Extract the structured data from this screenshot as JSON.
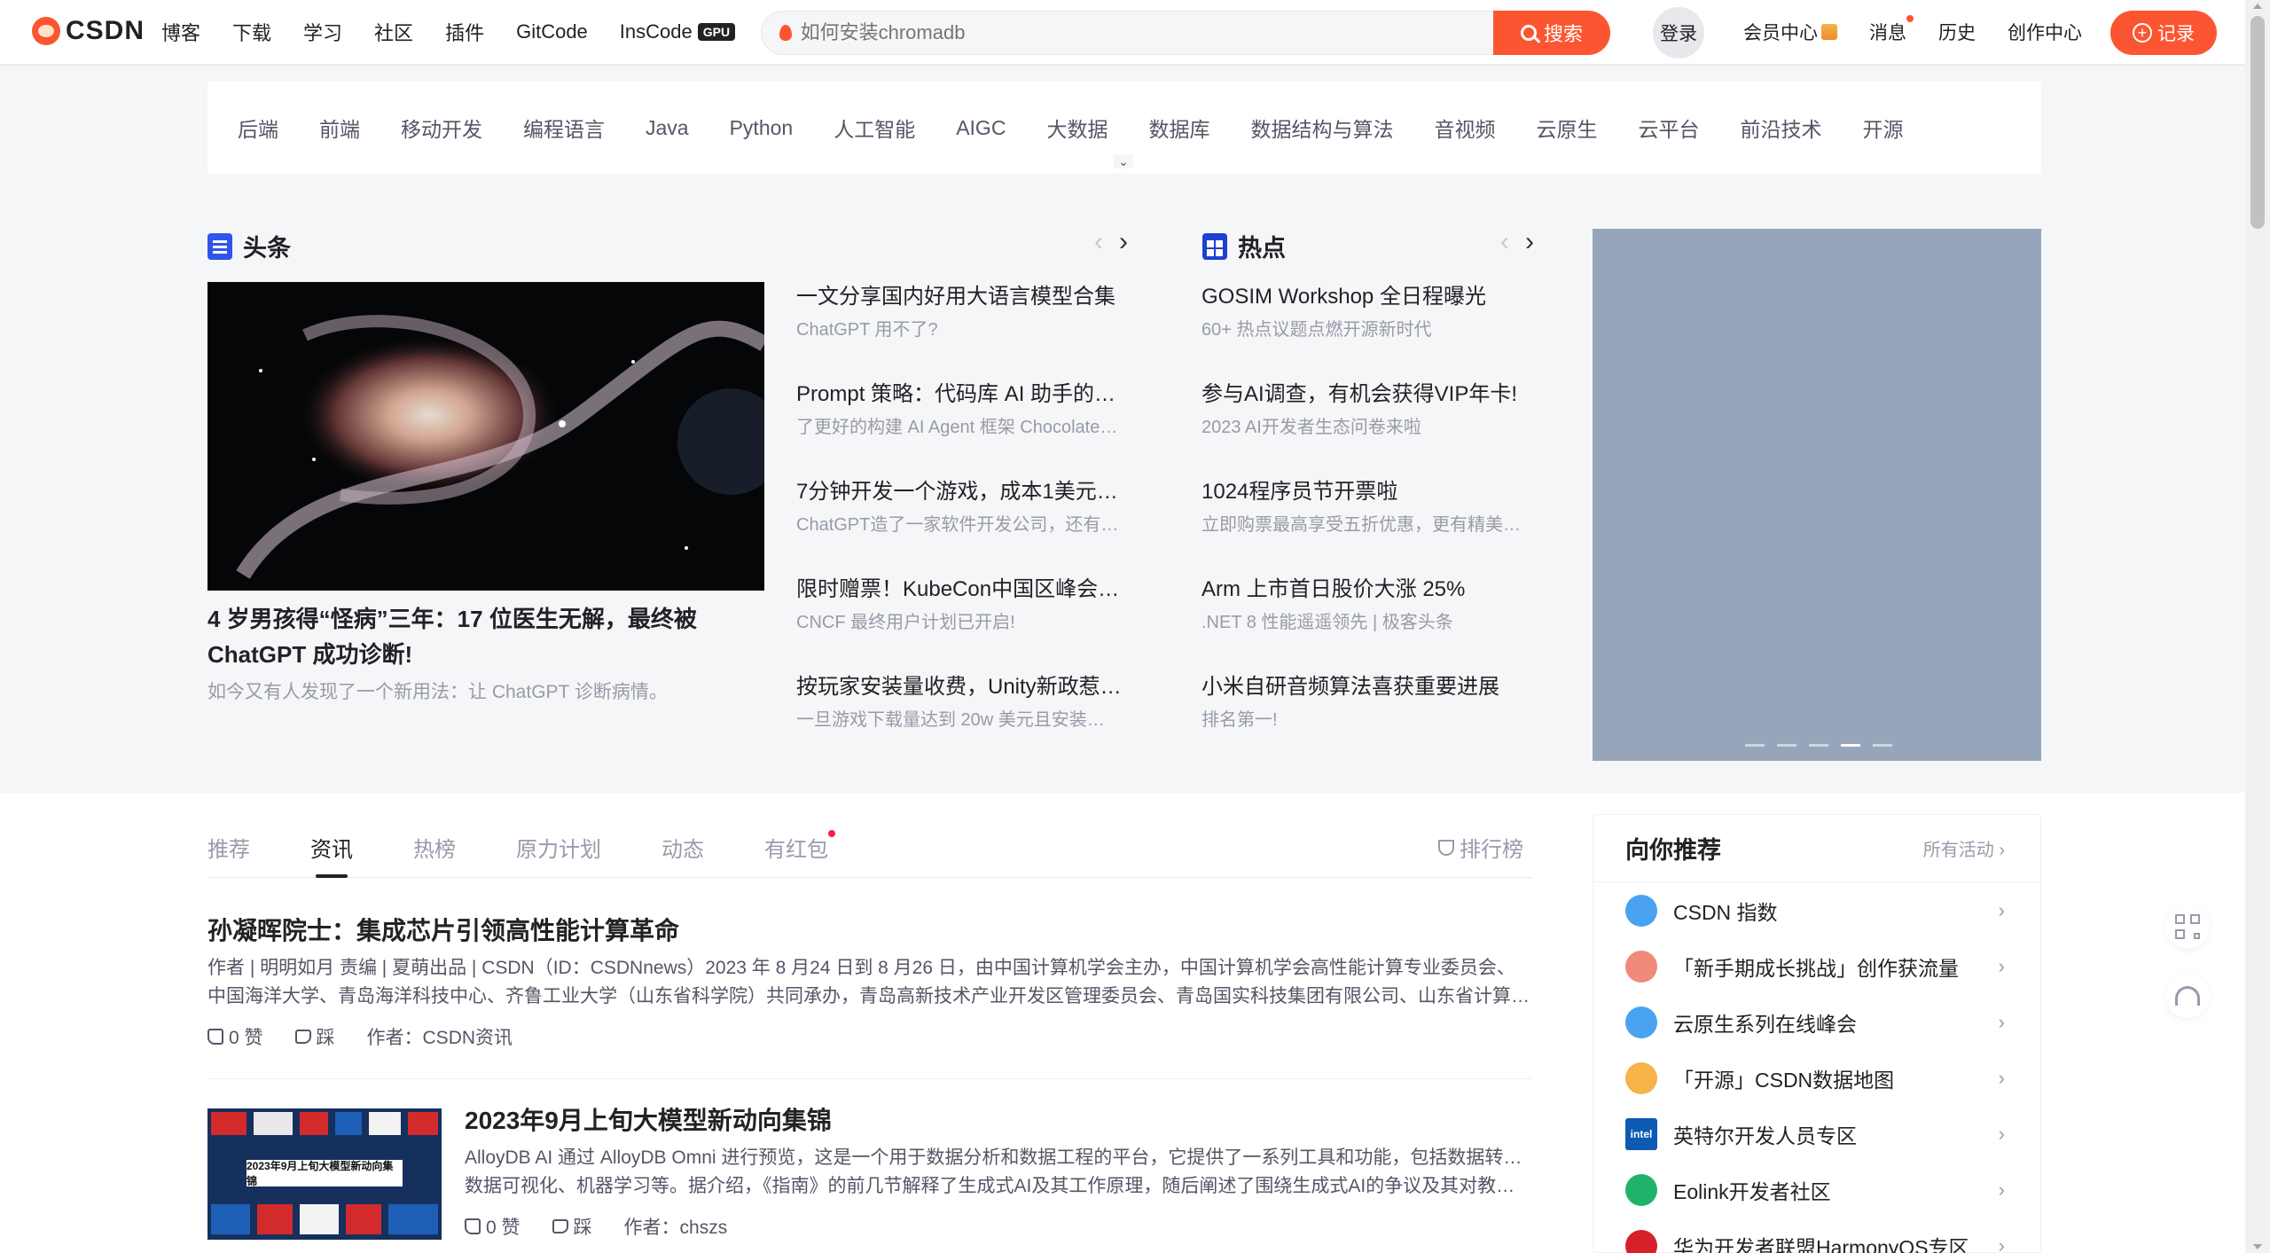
{
  "toolbar": {
    "logo": "CSDN",
    "nav": [
      "博客",
      "下载",
      "学习",
      "社区",
      "插件",
      "GitCode",
      "InsCode"
    ],
    "gpu_badge": "GPU",
    "search": {
      "placeholder": "如何安装chromadb",
      "button": "搜索"
    },
    "login": "登录",
    "links": [
      "会员中心",
      "消息",
      "历史",
      "创作中心"
    ],
    "record": "记录"
  },
  "categories": [
    "后端",
    "前端",
    "移动开发",
    "编程语言",
    "Java",
    "Python",
    "人工智能",
    "AIGC",
    "大数据",
    "数据库",
    "数据结构与算法",
    "音视频",
    "云原生",
    "云平台",
    "前沿技术",
    "开源"
  ],
  "headline": {
    "title": "头条",
    "main_title": "4 岁男孩得“怪病”三年：17 位医生无解，最终被 ChatGPT 成功诊断!",
    "main_sub": "如今又有人发现了一个新用法：让 ChatGPT 诊断病情。",
    "items": [
      {
        "t": "一文分享国内好用大语言模型合集",
        "s": "ChatGPT 用不了?"
      },
      {
        "t": "Prompt 策略：代码库 AI 助手的…",
        "s": "了更好的构建 AI Agent 框架 Chocolate…"
      },
      {
        "t": "7分钟开发一个游戏，成本1美元…",
        "s": "ChatGPT造了一家软件开发公司，还有…"
      },
      {
        "t": "限时赠票！KubeCon中国区峰会…",
        "s": "CNCF 最终用户计划已开启!"
      },
      {
        "t": "按玩家安装量收费，Unity新政惹…",
        "s": "一旦游戏下载量达到 20w 美元且安装…"
      }
    ]
  },
  "hot": {
    "title": "热点",
    "items": [
      {
        "t": "GOSIM Workshop 全日程曝光",
        "s": "60+ 热点议题点燃开源新时代"
      },
      {
        "t": "参与AI调查，有机会获得VIP年卡!",
        "s": "2023 AI开发者生态问卷来啦"
      },
      {
        "t": "1024程序员节开票啦",
        "s": "立即购票最高享受五折优惠，更有精美…"
      },
      {
        "t": "Arm 上市首日股价大涨 25%",
        "s": ".NET 8 性能遥遥领先 | 极客头条"
      },
      {
        "t": "小米自研音频算法喜获重要进展",
        "s": "排名第一!"
      }
    ]
  },
  "banner": {
    "slide_count": 5,
    "active_slide": 4
  },
  "tabs": [
    "推荐",
    "资讯",
    "热榜",
    "原力计划",
    "动态",
    "有红包"
  ],
  "active_tab": "资讯",
  "ranking": "排行榜",
  "articles": [
    {
      "title": "孙凝晖院士：集成芯片引领高性能计算革命",
      "desc1": "作者 | 明明如月 责编 | 夏萌出品 | CSDN（ID：CSDNnews）2023 年 8 月24 日到 8 月26 日，由中国计算机学会主办，中国计算机学会高性能计算专业委员会、",
      "desc2": "中国海洋大学、青岛海洋科技中心、齐鲁工业大学（山东省科学院）共同承办，青岛高新技术产业开发区管理委员会、青岛国实科技集团有限公司、山东省计算…",
      "likes": "0 赞",
      "dislike": "踩",
      "author": "作者：CSDN资讯"
    },
    {
      "title": "2023年9月上旬大模型新动向集锦",
      "thumb_caption": "2023年9月上旬大模型新动向集锦",
      "desc1": "AlloyDB AI 通过 AlloyDB Omni 进行预览，这是一个用于数据分析和数据工程的平台，它提供了一系列工具和功能，包括数据转换、",
      "desc2": "数据可视化、机器学习等。据介绍，《指南》的前几节解释了生成式AI及其工作原理，随后阐述了围绕生成式AI的争议及其对教…",
      "likes": "0 赞",
      "dislike": "踩",
      "author": "作者：chszs"
    }
  ],
  "recommend": {
    "title": "向你推荐",
    "more": "所有活动",
    "items": [
      {
        "label": "CSDN 指数",
        "icon": "chart-icon",
        "color": "#4aa3f0"
      },
      {
        "label": "「新手期成长挑战」创作获流量",
        "icon": "growth-icon",
        "color": "#f08a7a"
      },
      {
        "label": "云原生系列在线峰会",
        "icon": "cloud-icon",
        "color": "#4aa3f0"
      },
      {
        "label": "「开源」CSDN数据地图",
        "icon": "map-icon",
        "color": "#f6b34a"
      },
      {
        "label": "英特尔开发人员专区",
        "icon": "intel-icon",
        "color": "#0b5ab4",
        "text": "intel"
      },
      {
        "label": "Eolink开发者社区",
        "icon": "eolink-icon",
        "color": "#1fb36a"
      },
      {
        "label": "华为开发者联盟HarmonyOS专区",
        "icon": "huawei-icon",
        "color": "#d6202a"
      }
    ]
  },
  "colors": {
    "brand": "#fc5531",
    "banner": "#97a5bb"
  }
}
